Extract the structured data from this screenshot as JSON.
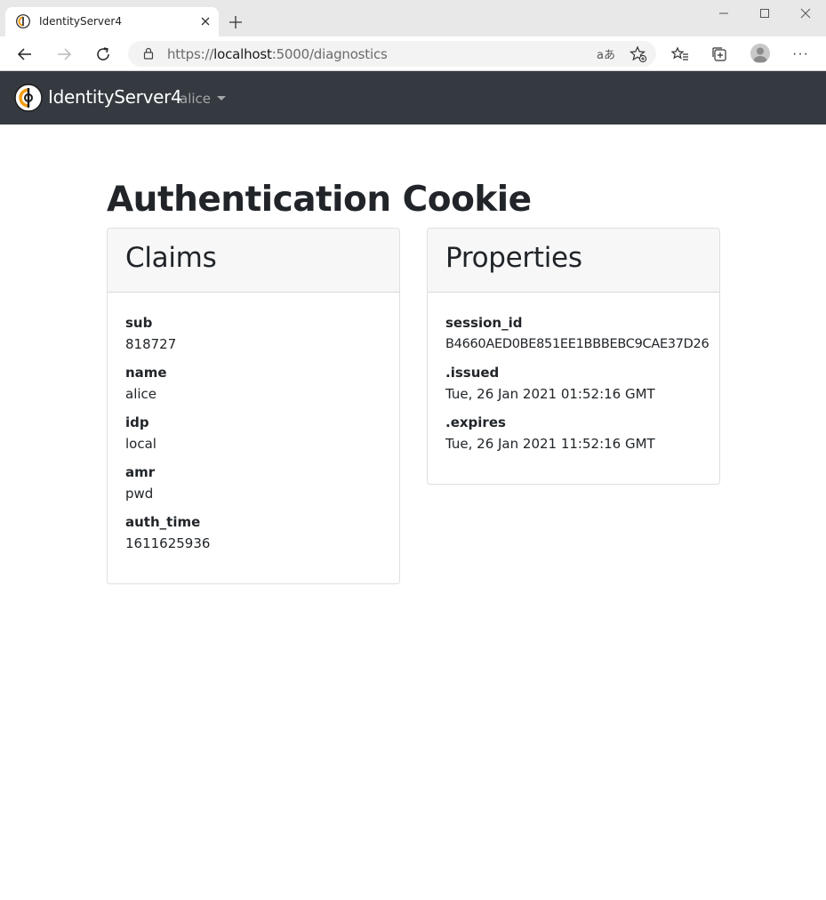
{
  "browser": {
    "tab_title": "IdentityServer4",
    "url_scheme": "https://",
    "url_host": "localhost",
    "url_rest": ":5000/diagnostics",
    "read_aloud_label": "aあ"
  },
  "navbar": {
    "brand": "IdentityServer4",
    "user": "alice",
    "background": "#343a40",
    "logo_accent": "#f39c12"
  },
  "page": {
    "title": "Authentication Cookie"
  },
  "claims": {
    "title": "Claims",
    "items": [
      {
        "key": "sub",
        "value": "818727"
      },
      {
        "key": "name",
        "value": "alice"
      },
      {
        "key": "idp",
        "value": "local"
      },
      {
        "key": "amr",
        "value": "pwd"
      },
      {
        "key": "auth_time",
        "value": "1611625936"
      }
    ]
  },
  "properties": {
    "title": "Properties",
    "items": [
      {
        "key": "session_id",
        "value": "B4660AED0BE851EE1BBBEBC9CAE37D26"
      },
      {
        "key": ".issued",
        "value": "Tue, 26 Jan 2021 01:52:16 GMT"
      },
      {
        "key": ".expires",
        "value": "Tue, 26 Jan 2021 11:52:16 GMT"
      }
    ]
  }
}
